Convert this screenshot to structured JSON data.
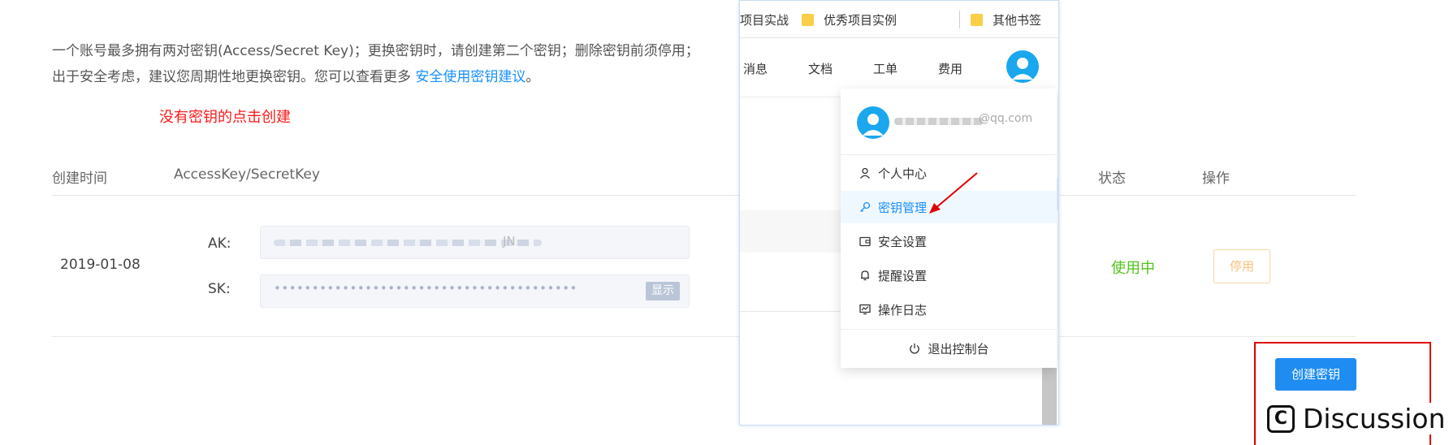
{
  "description": {
    "text": "一个账号最多拥有两对密钥(Access/Secret Key)；更换密钥时，请创建第二个密钥；删除密钥前须停用；出于安全考虑，建议您周期性地更换密钥。您可以查看更多 ",
    "link": "安全使用密钥建议",
    "end": "。"
  },
  "hint": "没有密钥的点击创建",
  "table": {
    "headers": {
      "created": "创建时间",
      "keys": "AccessKey/SecretKey",
      "status": "状态",
      "action": "操作"
    },
    "row": {
      "date": "2019-01-08",
      "ak_label": "AK:",
      "ak_tail": "JN",
      "sk_label": "SK:",
      "sk_value": "••••••••••••••••••••••••••••••••••••••••",
      "show_label": "显示",
      "status": "使用中",
      "disable_label": "停用"
    }
  },
  "create_button": "创建密钥",
  "watermark": {
    "icon": "C",
    "text": "Discussion"
  },
  "overlay": {
    "bookmarks": [
      {
        "label": "项目实战",
        "folder": false
      },
      {
        "label": "优秀项目实例",
        "folder": true
      },
      {
        "label": "其他书签",
        "folder": true
      }
    ],
    "nav": [
      "消息",
      "文档",
      "工单",
      "费用"
    ],
    "dropdown": {
      "email": "@qq.com",
      "items": [
        "个人中心",
        "密钥管理",
        "安全设置",
        "提醒设置",
        "操作日志"
      ],
      "logout": "退出控制台"
    }
  },
  "colors": {
    "accent": "#1890ff",
    "success": "#52c41a",
    "warning": "#f6c27a",
    "danger": "#ff1a1a"
  }
}
